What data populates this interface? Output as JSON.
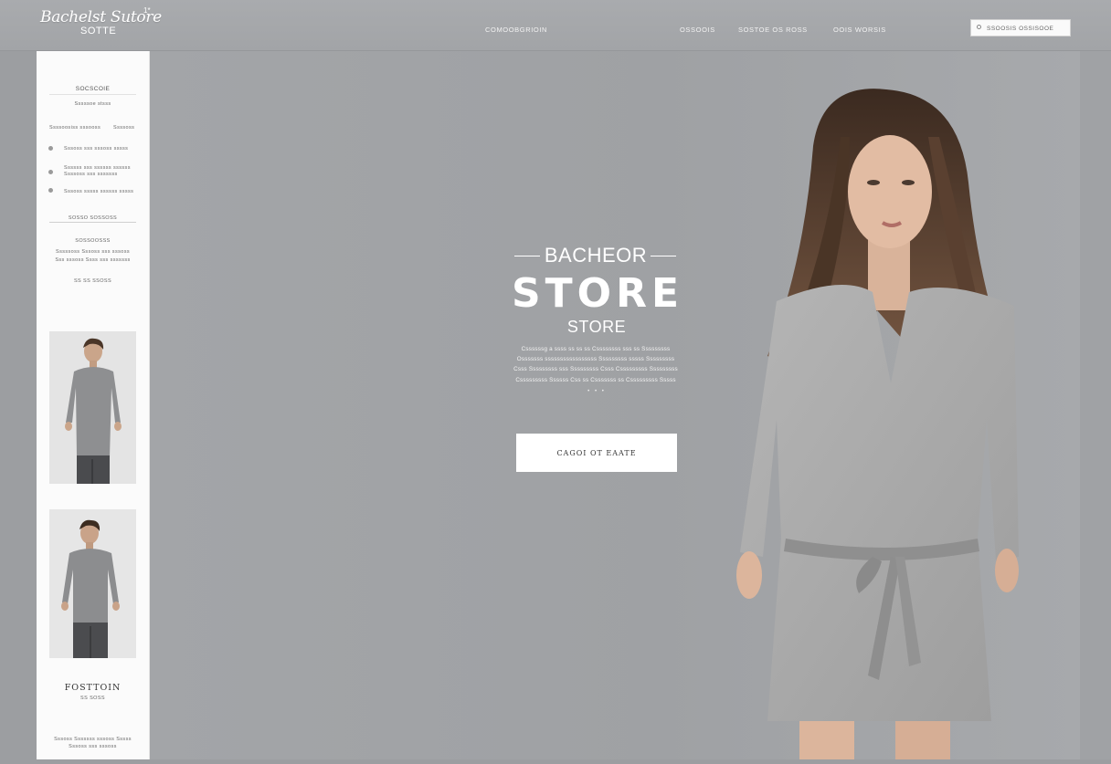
{
  "brand": {
    "logo_main": "Bachelst Sutore",
    "logo_mark": "1*",
    "logo_sub": "SOTTE"
  },
  "nav": {
    "center_link": "COMOOBGRIOIN",
    "links": [
      "OSSOOIS",
      "SOSTOE OS ROSS",
      "OOIS WORSIS"
    ]
  },
  "search": {
    "placeholder": "SSOOSIS OSSISOOE"
  },
  "sidebar": {
    "header": "SOCSCOIE",
    "header_sub": "Sssssoe stsss",
    "filter_label": "Ssssoosiss sssooss",
    "filter_value": "Ssssoss",
    "items": [
      "Sssoss sss sssoss sssss",
      "Ssssss sss ssssss ssssss",
      "Sssoss sssss ssssss sssss"
    ],
    "item_two_line": "Ssssoss sss sssssss",
    "section_title": "SOSSO SOSSOSS",
    "section_label": "SOSSOOSSS",
    "section_text_1": "Sssssoss Sssoss sss sssoss",
    "section_text_2": "Sss sssoss Ssss sss sssssss",
    "section_more": "SS SS SSOSS",
    "footer_title": "FOSTTOIN",
    "footer_sub": "SS SOSS",
    "footer_text_1": "Sssoss Sssssss sssoss Sssss",
    "footer_text_2": "Sssoss sss sssoss"
  },
  "hero": {
    "kicker": "BACHEOR",
    "title": "STORE",
    "subtitle": "STORE",
    "copy_lines": [
      "Cssssssg a ssss ss ss ss Cssssssss sss ss Sssssssss",
      "Osssssss sssssssssssssssss Sssssssss sssss Sssssssss",
      "Csss Sssssssss sss Sssssssss Csss Csssssssss Sssssssss",
      "Csssssssss Ssssss Css ss Csssssss ss Csssssssss Sssss"
    ],
    "dots": "• • •",
    "cta_label": "CAGOI OT EAATE"
  },
  "colors": {
    "background": "#9c9ea1",
    "topbar": "#a6a8ab",
    "sidebar": "#fbfbfb",
    "cta": "#ffffff"
  }
}
